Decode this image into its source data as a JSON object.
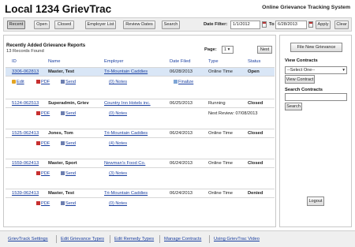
{
  "header": {
    "title": "Local 1234 GrievTrac",
    "subtitle": "Online Grievance Tracking System"
  },
  "toolbar": {
    "recent": "Recent",
    "open": "Open",
    "closed": "Closed",
    "employer_list": "Employer List",
    "review_dates": "Review Dates",
    "search": "Search",
    "date_filter_label": "Date Filter:",
    "from_date": "1/1/2012",
    "to_label": "To",
    "to_date": "6/28/2013",
    "apply": "Apply",
    "clear": "Clear"
  },
  "reports": {
    "heading": "Recently Added Grievance Reports",
    "count": "13 Records Found",
    "page_label": "Page:",
    "page_value": "1",
    "next": "Next",
    "columns": {
      "id": "ID",
      "name": "Name",
      "employer": "Employer",
      "date_filed": "Date Filed",
      "type": "Type",
      "status": "Status"
    },
    "rows": [
      {
        "id": "3306-062813",
        "name": "Master, Test",
        "employer": "Tri-Mountain Caddies",
        "date": "06/28/2013",
        "type": "Online Time",
        "status": "Open",
        "edit": "Edit",
        "pdf": "PDF",
        "send": "Send",
        "notes": "(0) Notes",
        "finalize": "Finalize"
      },
      {
        "id": "5124-062513",
        "name": "Superadmin, Griev",
        "employer": "Country Inn Hotels inc.",
        "date": "06/25/2013",
        "type": "Running",
        "status": "Closed",
        "pdf": "PDF",
        "send": "Send",
        "notes": "(0) Notes",
        "review": "Next Review: 07/08/2013"
      },
      {
        "id": "1525-062413",
        "name": "Jones, Tom",
        "employer": "Tri-Mountain Caddies",
        "date": "06/24/2013",
        "type": "Online Time",
        "status": "Closed",
        "pdf": "PDF",
        "send": "Send",
        "notes": "(4) Notes"
      },
      {
        "id": "1559-062413",
        "name": "Master, Sport",
        "employer": "Newman's Food Co.",
        "date": "06/24/2013",
        "type": "Online Time",
        "status": "Closed",
        "pdf": "PDF",
        "send": "Send",
        "notes": "(3) Notes"
      },
      {
        "id": "1539-062413",
        "name": "Master, Test",
        "employer": "Tri-Mountain Caddies",
        "date": "06/24/2013",
        "type": "Online Time",
        "status": "Denied",
        "pdf": "PDF",
        "send": "Send",
        "notes": "(0) Notes"
      }
    ]
  },
  "sidebar": {
    "file_new": "File New Grievance",
    "view_contracts_label": "View Contracts",
    "contract_select": "--Select One--",
    "view_contract_btn": "View Contract",
    "search_contracts_label": "Search Contracts",
    "search_btn": "Search",
    "logout": "Logout"
  },
  "footer": {
    "links": [
      "GrievTrack Settings",
      "Edit Grievance Types",
      "Edit Remedy Types",
      "Manage Contracts",
      "Using GrievTrac Video"
    ]
  }
}
